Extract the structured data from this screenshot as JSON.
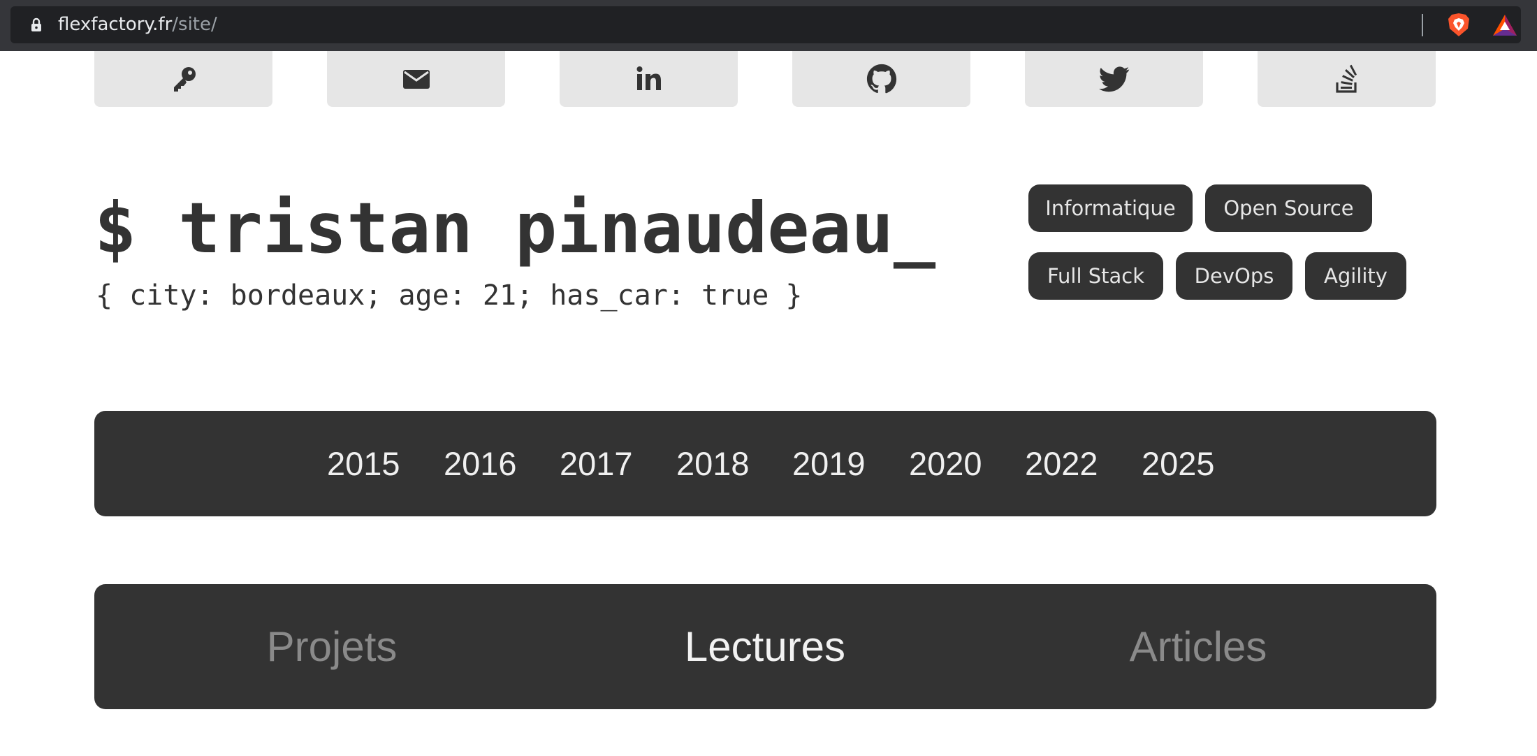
{
  "browser": {
    "url_domain": "flexfactory.fr",
    "url_path": "/site/"
  },
  "social_links": [
    {
      "icon": "key-icon"
    },
    {
      "icon": "envelope-icon"
    },
    {
      "icon": "linkedin-icon"
    },
    {
      "icon": "github-icon"
    },
    {
      "icon": "twitter-icon"
    },
    {
      "icon": "stackoverflow-icon"
    }
  ],
  "header": {
    "title": "$ tristan pinaudeau_",
    "subtitle": "{ city: bordeaux; age: 21; has_car: true }"
  },
  "tags": [
    "Informatique",
    "Open Source",
    "Full Stack",
    "DevOps",
    "Agility"
  ],
  "years": [
    "2015",
    "2016",
    "2017",
    "2018",
    "2019",
    "2020",
    "2022",
    "2025"
  ],
  "sections": {
    "items": [
      "Projets",
      "Lectures",
      "Articles"
    ],
    "active": "Lectures"
  },
  "colors": {
    "dark": "#333333",
    "light_button": "#e6e6e6",
    "inactive_tab": "#8a8a8a"
  }
}
